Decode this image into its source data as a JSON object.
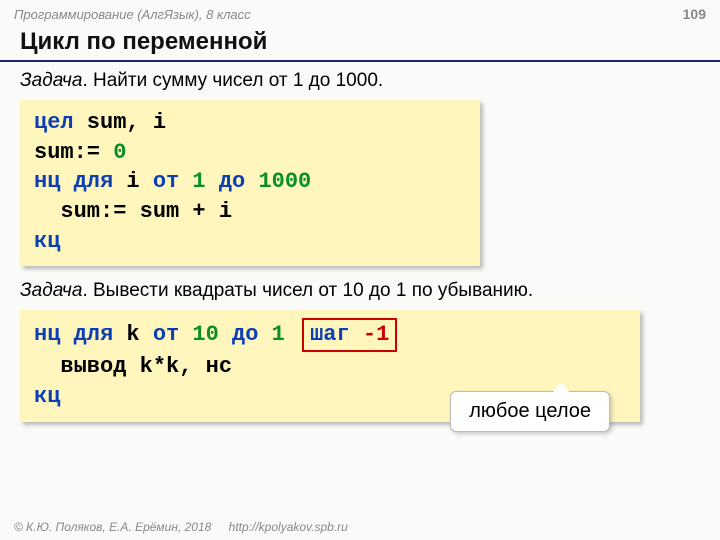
{
  "header": {
    "course": "Программирование (АлгЯзык), 8 класс",
    "page": "109"
  },
  "title": "Цикл по переменной",
  "task1": {
    "label": "Задача",
    "text": ". Найти сумму чисел от 1 до 1000."
  },
  "code1": {
    "l1_kw": "цел",
    "l1_rest": " sum, i",
    "l2_a": "sum:= ",
    "l2_num": "0",
    "l3_nc": "нц для",
    "l3_mid": " i ",
    "l3_ot": "от",
    "l3_n1": " 1 ",
    "l3_do": "до",
    "l3_n2": " 1000",
    "l4": "  sum:= sum + i",
    "l5": "кц"
  },
  "task2": {
    "label": "Задача",
    "text": ". Вывести квадраты чисел от 10 до 1 по убыванию."
  },
  "code2": {
    "l1_nc": "нц для",
    "l1_mid": " k ",
    "l1_ot": "от",
    "l1_n1": " 10 ",
    "l1_do": "до",
    "l1_n2": " 1",
    "step_kw": "шаг ",
    "step_val": "-1",
    "l2": "  вывод k*k, нс",
    "l3": "кц"
  },
  "callout": "любое целое",
  "footer": {
    "copy": "© К.Ю. Поляков, Е.А. Ерёмин, 2018",
    "url": "http://kpolyakov.spb.ru"
  }
}
